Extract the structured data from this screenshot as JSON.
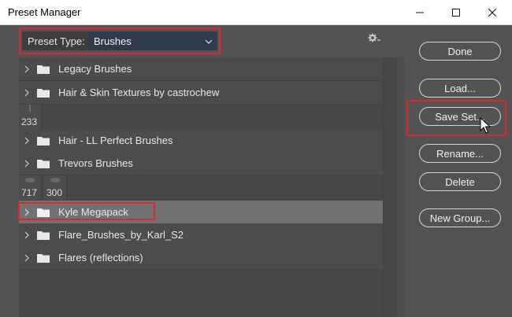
{
  "window": {
    "title": "Preset Manager",
    "controls": {
      "minimize": "—",
      "maximize": "☐",
      "close": "✕"
    }
  },
  "preset": {
    "label": "Preset Type:",
    "value": "Brushes"
  },
  "list": {
    "rows": [
      {
        "label": "Legacy Brushes"
      },
      {
        "label": "Hair & Skin Textures by castrochew"
      },
      {
        "label": "Hair - LL Perfect Brushes"
      },
      {
        "label": "Trevors Brushes"
      },
      {
        "label": "Kyle Megapack",
        "selected": true
      },
      {
        "label": "Flare_Brushes_by_Karl_S2"
      },
      {
        "label": "Flares (reflections)"
      }
    ],
    "thumb_sizes": [
      "233",
      "717",
      "300"
    ]
  },
  "buttons": {
    "done": "Done",
    "load": "Load...",
    "save_set": "Save Set...",
    "rename": "Rename...",
    "delete": "Delete",
    "new_group": "New Group..."
  },
  "colors": {
    "highlight": "#e0252f",
    "panel": "#535353",
    "selected_row": "#717171"
  }
}
